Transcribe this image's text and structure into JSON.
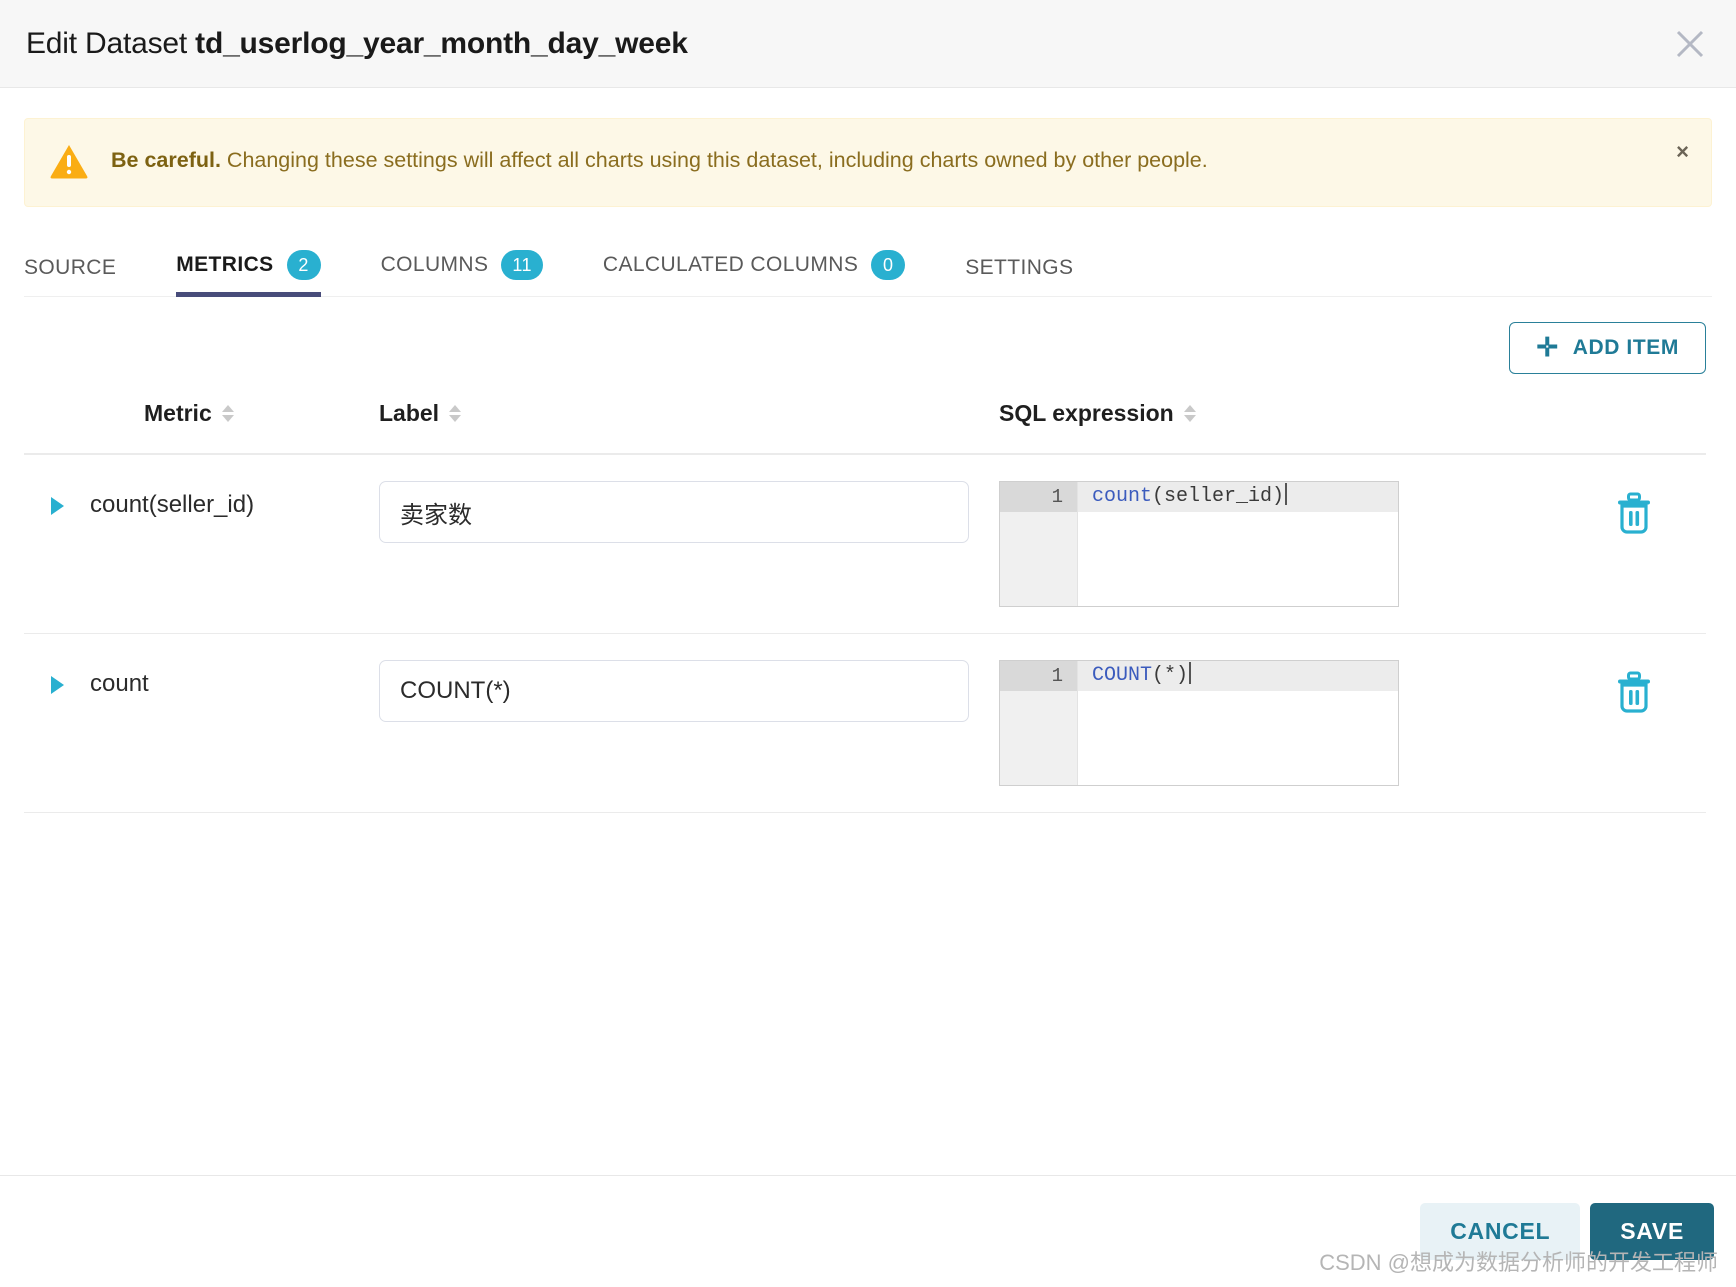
{
  "header": {
    "title_prefix": "Edit Dataset ",
    "dataset_name": "td_userlog_year_month_day_week",
    "close_icon": "close-icon"
  },
  "alert": {
    "strong": "Be careful.",
    "message": " Changing these settings will affect all charts using this dataset, including charts owned by other people.",
    "icon": "warning-triangle-icon",
    "dismiss": "×",
    "bg_color": "#fdf8e7",
    "text_color": "#8a6d1f"
  },
  "tabs": [
    {
      "label": "SOURCE",
      "badge": null,
      "active": false
    },
    {
      "label": "METRICS",
      "badge": "2",
      "active": true
    },
    {
      "label": "COLUMNS",
      "badge": "11",
      "active": false
    },
    {
      "label": "CALCULATED COLUMNS",
      "badge": "0",
      "active": false
    },
    {
      "label": "SETTINGS",
      "badge": null,
      "active": false
    }
  ],
  "toolbar": {
    "add_item_label": "ADD ITEM",
    "add_item_icon": "plus-icon",
    "accent_color": "#1f7a96"
  },
  "table": {
    "columns": [
      {
        "key": "metric",
        "header": "Metric"
      },
      {
        "key": "label",
        "header": "Label"
      },
      {
        "key": "sql",
        "header": "SQL expression"
      }
    ],
    "rows": [
      {
        "metric": "count(seller_id)",
        "label_value": "卖家数",
        "sql_line_number": "1",
        "sql_function": "count",
        "sql_args": "(seller_id)",
        "delete_icon": "trash-icon",
        "expander_icon": "chevron-right-icon"
      },
      {
        "metric": "count",
        "label_value": "COUNT(*)",
        "sql_line_number": "1",
        "sql_function": "COUNT",
        "sql_args": "(*)",
        "delete_icon": "trash-icon",
        "expander_icon": "chevron-right-icon"
      }
    ]
  },
  "footer": {
    "cancel_label": "CANCEL",
    "save_label": "SAVE",
    "watermark": "CSDN @想成为数据分析师的开发工程师"
  },
  "badge_color": "#29b0d0"
}
